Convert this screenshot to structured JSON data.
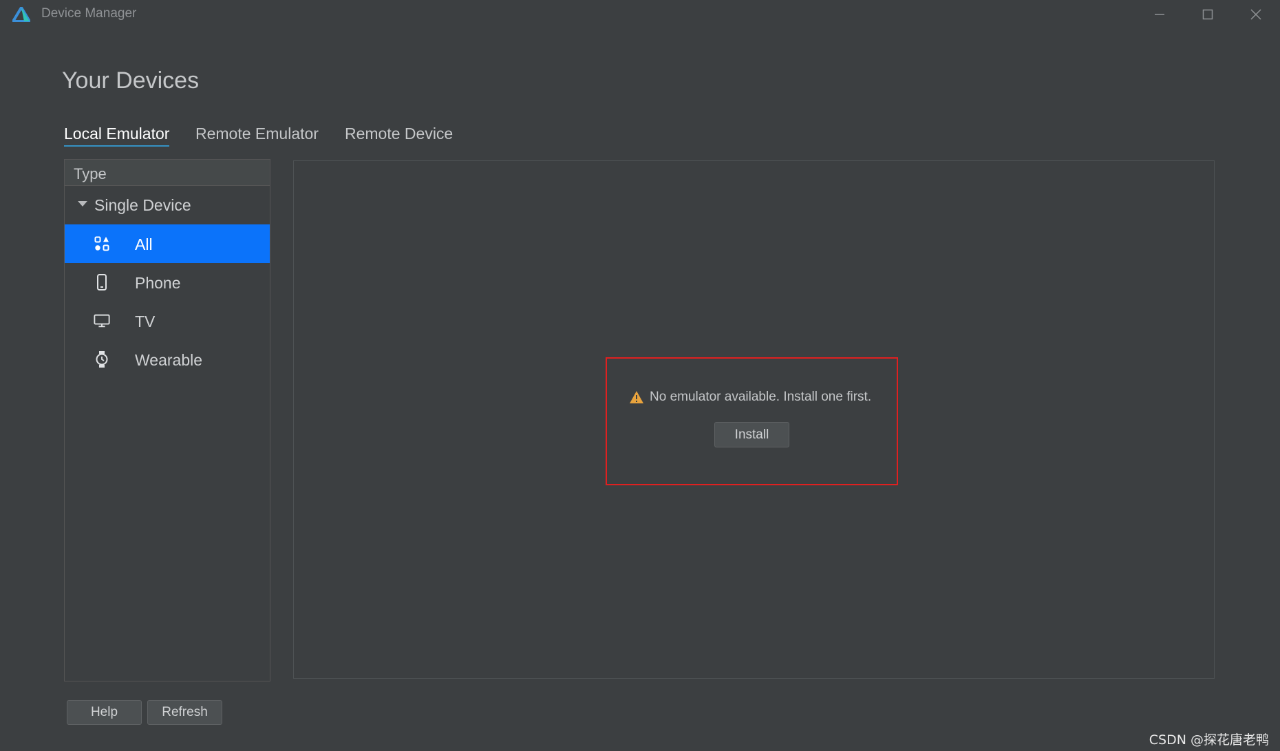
{
  "window": {
    "title": "Device Manager",
    "controls": [
      "minimize-icon",
      "maximize-icon",
      "close-icon"
    ]
  },
  "page": {
    "title": "Your Devices"
  },
  "tabs": [
    {
      "label": "Local Emulator",
      "active": true
    },
    {
      "label": "Remote Emulator",
      "active": false
    },
    {
      "label": "Remote Device",
      "active": false
    }
  ],
  "sidebar": {
    "header": "Type",
    "group": {
      "label": "Single Device",
      "expanded": true
    },
    "items": [
      {
        "label": "All",
        "icon": "all-categories-icon",
        "selected": true
      },
      {
        "label": "Phone",
        "icon": "phone-icon",
        "selected": false
      },
      {
        "label": "TV",
        "icon": "tv-icon",
        "selected": false
      },
      {
        "label": "Wearable",
        "icon": "watch-icon",
        "selected": false
      }
    ]
  },
  "main": {
    "empty_message": "No emulator available. Install one first.",
    "install_label": "Install"
  },
  "footer": {
    "help_label": "Help",
    "refresh_label": "Refresh"
  },
  "watermark": "CSDN @探花唐老鸭",
  "colors": {
    "background": "#3c3f41",
    "selection": "#0b73fa",
    "tab_underline": "#3592c4",
    "highlight_border": "#e02020",
    "warning": "#e8a33d"
  }
}
